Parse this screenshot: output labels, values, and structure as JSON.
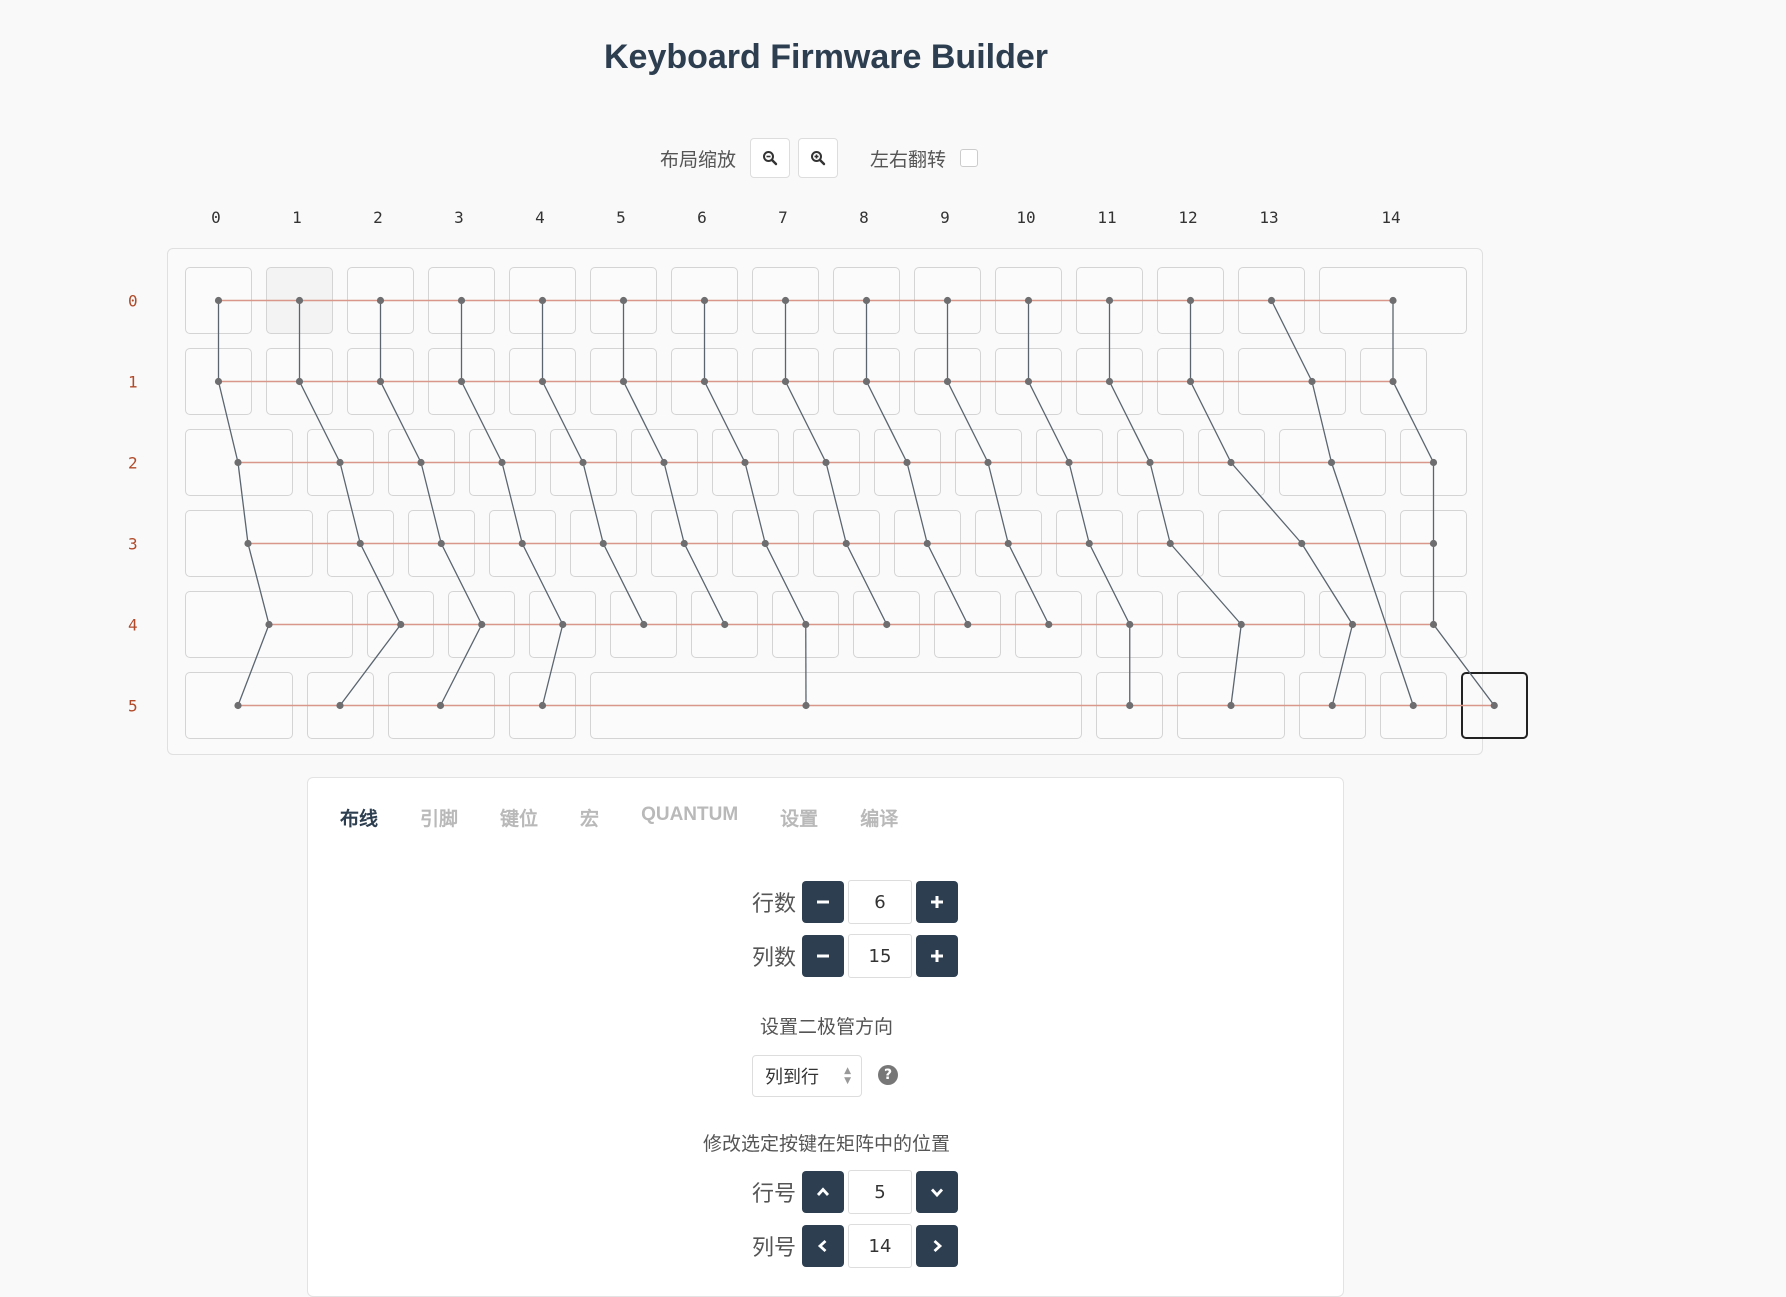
{
  "app": {
    "title": "Keyboard Firmware Builder"
  },
  "toolbar": {
    "zoom_label": "布局缩放",
    "flip_label": "左右翻转",
    "flip_checked": false,
    "zoom_out_icon": "zoom-out-icon",
    "zoom_in_icon": "zoom-in-icon"
  },
  "matrix": {
    "col_labels": [
      "0",
      "1",
      "2",
      "3",
      "4",
      "5",
      "6",
      "7",
      "8",
      "9",
      "10",
      "11",
      "12",
      "13",
      "14"
    ],
    "row_labels": [
      "0",
      "1",
      "2",
      "3",
      "4",
      "5"
    ],
    "row_wire_color": "#d8978a",
    "col_wire_color": "#5a6570",
    "node_color": "#6e6e70",
    "selected_key": {
      "row": 5,
      "col": 14
    },
    "hovered_key": {
      "row": 0,
      "col": 1
    }
  },
  "tabs": [
    {
      "label": "布线",
      "active": true
    },
    {
      "label": "引脚",
      "active": false
    },
    {
      "label": "键位",
      "active": false
    },
    {
      "label": "宏",
      "active": false
    },
    {
      "label": "QUANTUM",
      "active": false
    },
    {
      "label": "设置",
      "active": false
    },
    {
      "label": "编译",
      "active": false
    }
  ],
  "wiring": {
    "rows_label": "行数",
    "rows_value": "6",
    "cols_label": "列数",
    "cols_value": "15",
    "diode_title": "设置二极管方向",
    "diode_value": "列到行",
    "help_icon": "question-circle-icon",
    "move_title": "修改选定按键在矩阵中的位置",
    "row_pos_label": "行号",
    "row_pos_value": "5",
    "col_pos_label": "列号",
    "col_pos_value": "14"
  }
}
